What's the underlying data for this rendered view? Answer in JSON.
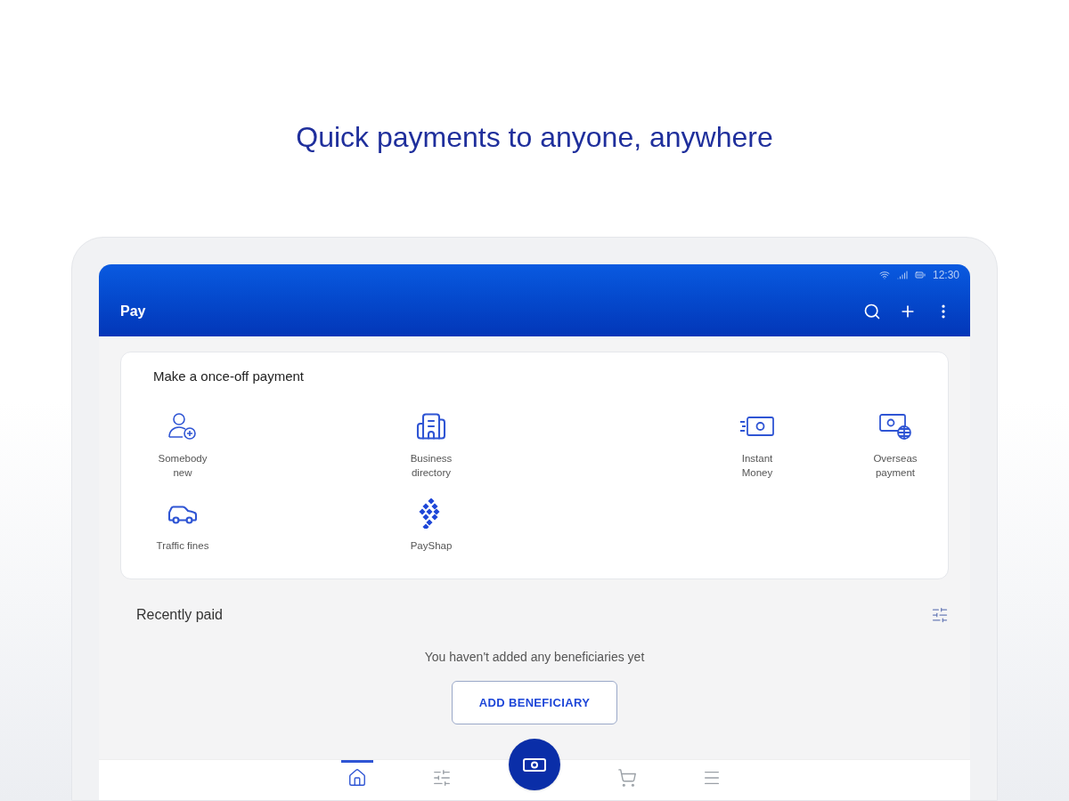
{
  "headline": "Quick payments to anyone, anywhere",
  "status_bar": {
    "time": "12:30"
  },
  "app_bar": {
    "title": "Pay"
  },
  "once_off": {
    "title": "Make a once-off payment",
    "options": [
      {
        "kind": "person",
        "label": "Somebody new"
      },
      {
        "kind": "building",
        "label": "Business directory"
      },
      {
        "kind": "money",
        "label": "Instant Money"
      },
      {
        "kind": "globe",
        "label": "Overseas payment"
      },
      {
        "kind": "car",
        "label": "Traffic fines"
      },
      {
        "kind": "dots",
        "label": "PayShap"
      }
    ]
  },
  "recently_paid": {
    "title": "Recently paid",
    "empty_message": "You haven't added any beneficiaries yet",
    "button": "ADD BENEFICIARY"
  },
  "bottom_nav": [
    {
      "kind": "home",
      "selected": true
    },
    {
      "kind": "sliders",
      "selected": false
    },
    {
      "kind": "fab",
      "selected": false
    },
    {
      "kind": "cart",
      "selected": false
    },
    {
      "kind": "menu",
      "selected": false
    }
  ]
}
